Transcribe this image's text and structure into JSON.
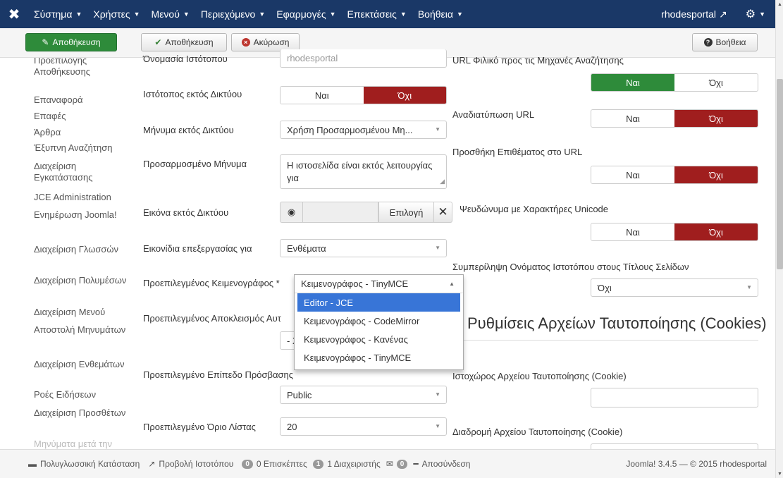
{
  "navbar": {
    "logo": "joomla-logo",
    "menu": [
      "Σύστημα",
      "Χρήστες",
      "Μενού",
      "Περιεχόμενο",
      "Εφαρμογές",
      "Επεκτάσεις",
      "Βοήθεια"
    ],
    "site_name": "rhodesportal",
    "settings_icon": "gear-icon"
  },
  "toolbar": {
    "save_primary": "Αποθήκευση",
    "save": "Αποθήκευση",
    "cancel": "Ακύρωση",
    "help": "Βοήθεια"
  },
  "sidebar": {
    "items": [
      "Προεπιλογής Αποθήκευσης",
      "Επαναφορά",
      "Επαφές",
      "Άρθρα",
      "Έξυπνη Αναζήτηση",
      "Διαχείριση Εγκατάστασης",
      "JCE Administration",
      "Ενημέρωση Joomla!",
      "Διαχείριση Γλωσσών",
      "Διαχείριση Πολυμέσων",
      "Διαχείριση Μενού",
      "Αποστολή Μηνυμάτων",
      "Διαχείριση Ενθεμάτων",
      "Ροές Ειδήσεων",
      "Διαχείριση Προσθέτων",
      "Μηνύματα μετά την"
    ]
  },
  "form_left": {
    "site_name_label": "Όνομασία Ιστότοπου",
    "site_name_value": "rhodesportal",
    "offline_label": "Ιστότοπος εκτός Δικτύου",
    "offline_yes": "Ναι",
    "offline_no": "Όχι",
    "offline_msg_label": "Μήνυμα εκτός Δικτύου",
    "offline_msg_value": "Χρήση Προσαρμοσμένου Μη...",
    "custom_msg_label": "Προσαρμοσμένο Μήνυμα",
    "custom_msg_value": "Η ιστοσελίδα είναι εκτός λειτουργίας για",
    "offline_image_label": "Εικόνα εκτός Δικτύου",
    "offline_image_pick": "Επιλογή",
    "edit_icons_label": "Εικονίδια επεξεργασίας για",
    "edit_icons_value": "Ενθέματα",
    "default_editor_label": "Προεπιλεγμένος Κειμενογράφος *",
    "default_editor_value": "Κειμενογράφος - TinyMCE",
    "default_captcha_label": "Προεπιλεγμένος Αποκλεισμός Αυτ",
    "default_captcha_value": "- Χ",
    "default_access_label": "Προεπιλεγμένο Επίπεδο Πρόσβασης",
    "default_access_value": "Public",
    "default_list_label": "Προεπιλεγμένο Όριο Λίστας",
    "default_list_value": "20"
  },
  "editor_dropdown": {
    "selected": "Κειμενογράφος - TinyMCE",
    "options": [
      "Editor - JCE",
      "Κειμενογράφος - CodeMirror",
      "Κειμενογράφος - Κανένας",
      "Κειμενογράφος - TinyMCE"
    ],
    "highlighted_index": 0
  },
  "form_right": {
    "sef_label": "URL Φιλικό προς τις Μηχανές Αναζήτησης",
    "sef_yes": "Ναι",
    "sef_no": "Όχι",
    "rewrite_label": "Αναδιατύπωση URL",
    "rewrite_yes": "Ναι",
    "rewrite_no": "Όχι",
    "suffix_label": "Προσθήκη Επιθέματος στο URL",
    "suffix_yes": "Ναι",
    "suffix_no": "Όχι",
    "unicode_label": "Ψευδώνυμα με Χαρακτήρες Unicode",
    "unicode_yes": "Ναι",
    "unicode_no": "Όχι",
    "sitename_titles_label": "Συμπερίληψη Ονόματος Ιστοτόπου στους Τίτλους Σελίδων",
    "sitename_titles_value": "Όχι",
    "cookie_section_title": "Ρυθμίσεις Αρχείων Ταυτοποίησης (Cookies)",
    "cookie_domain_label": "Ιστοχώρος Αρχείου Ταυτοποίησης (Cookie)",
    "cookie_path_label": "Διαδρομή Αρχείου Ταυτοποίησης (Cookie)"
  },
  "statusbar": {
    "multilang": "Πολυγλωσσική Κατάσταση",
    "view_site": "Προβολή Ιστοτόπου",
    "visitors_count": "0",
    "visitors": "0 Επισκέπτες",
    "admins_count": "1",
    "admins": "1 Διαχειριστής",
    "messages_count": "0",
    "logout": "Αποσύνδεση",
    "copyright": "Joomla! 3.4.5 — © 2015 rhodesportal"
  }
}
